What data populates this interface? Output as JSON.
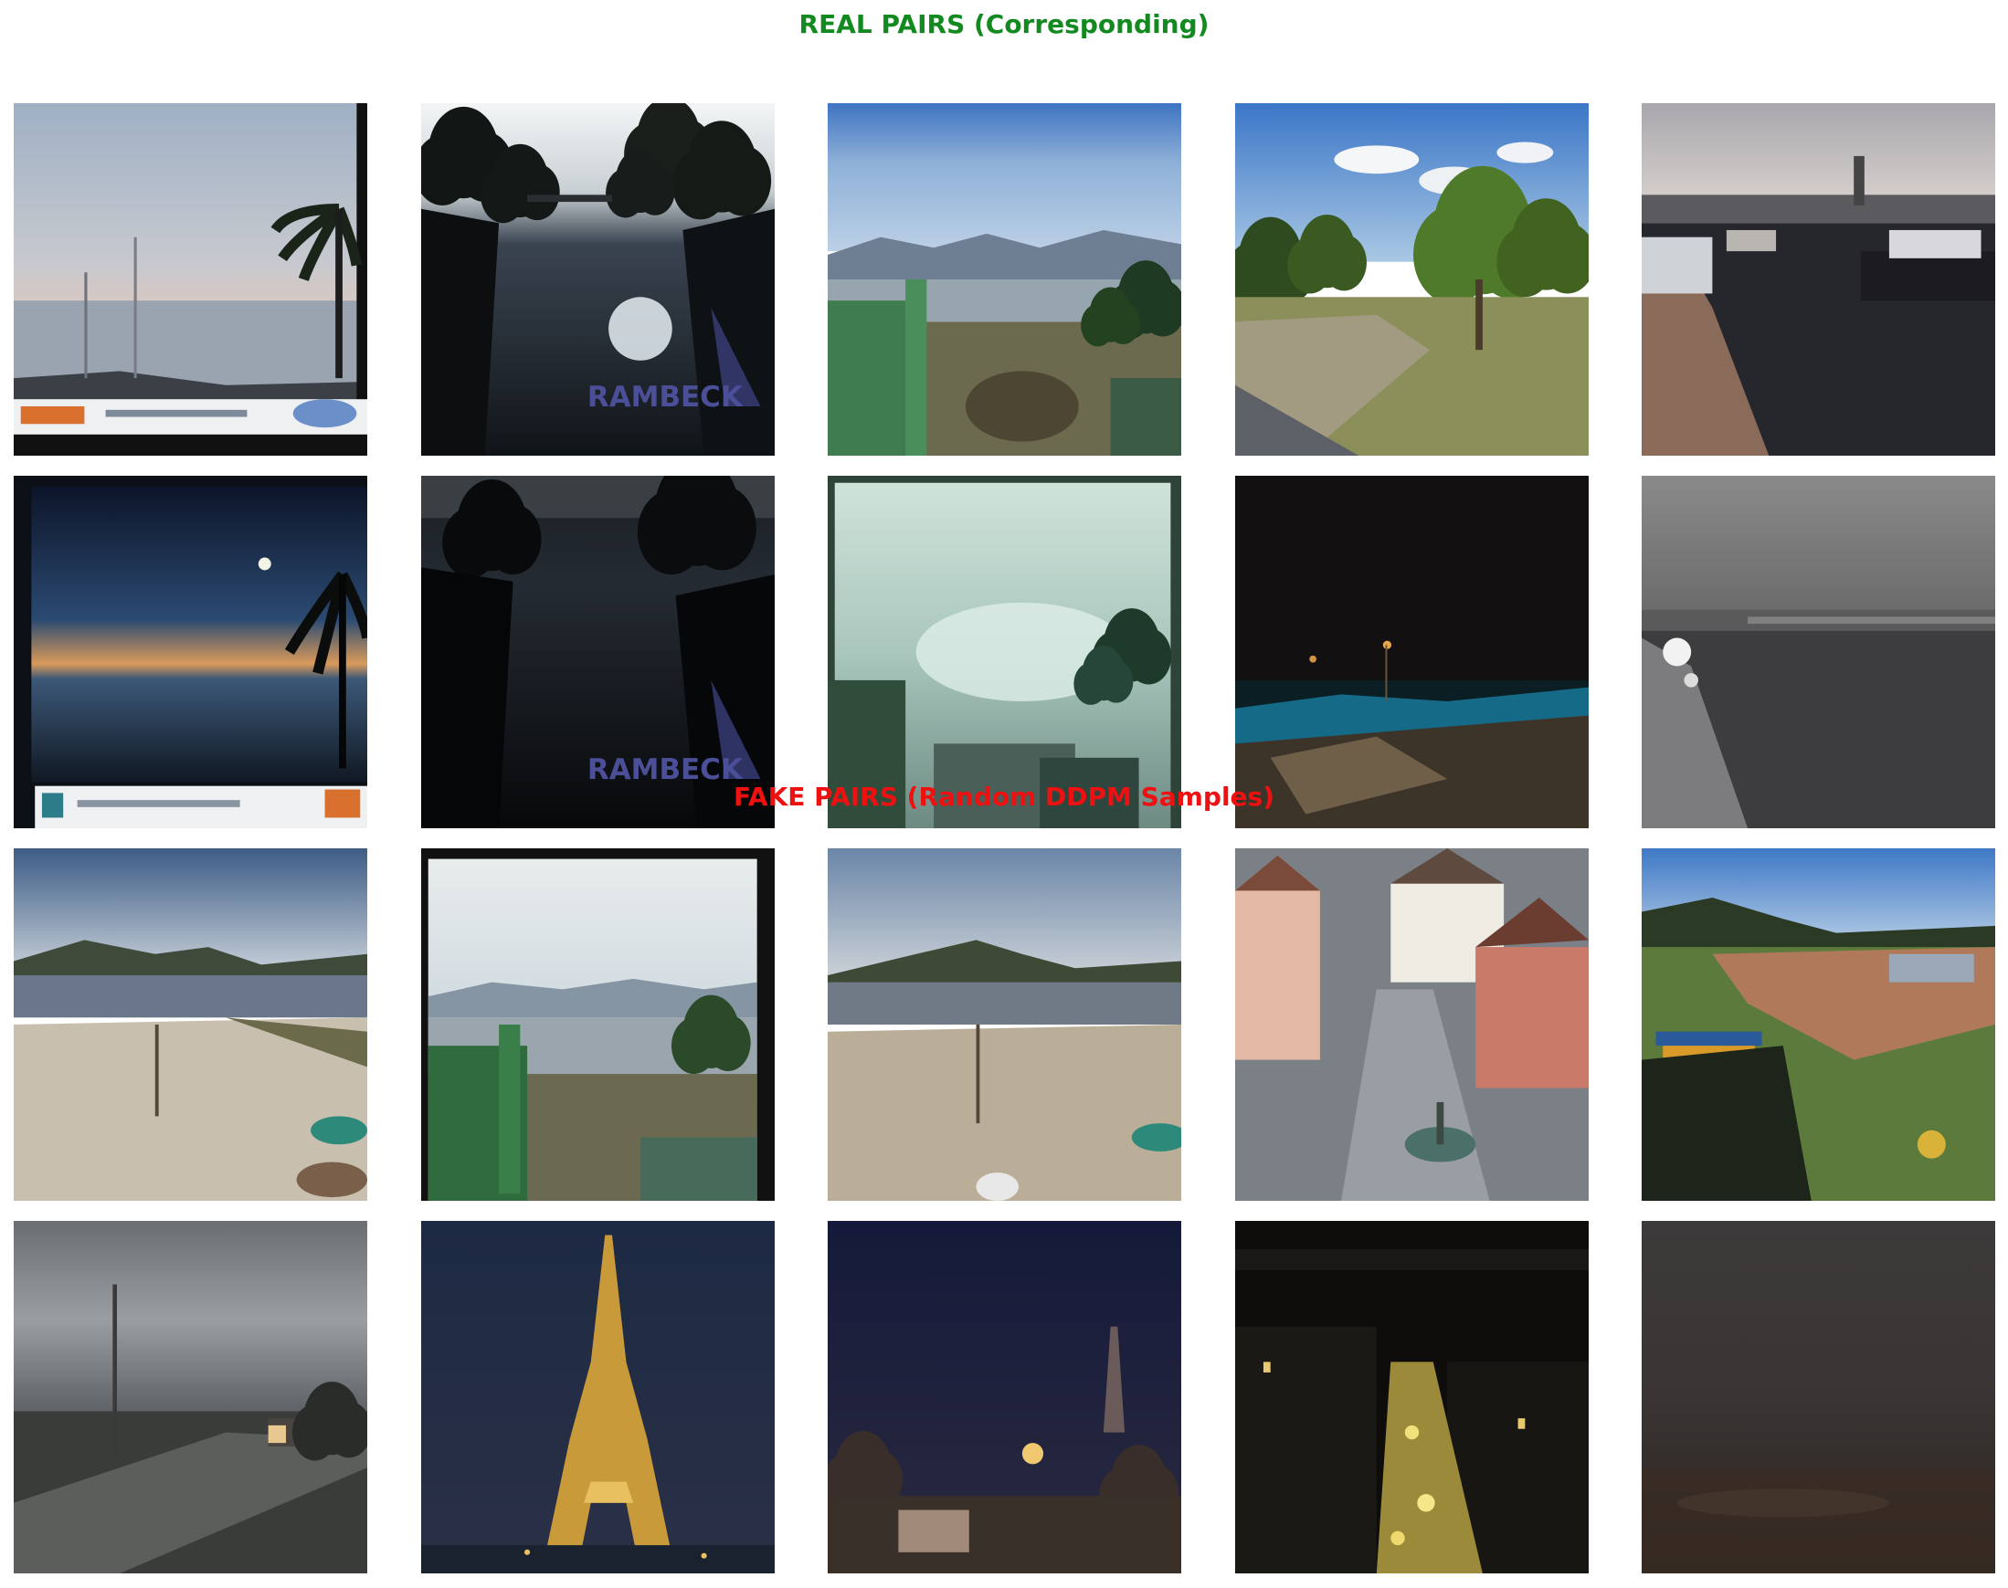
{
  "titles": {
    "real": "REAL PAIRS (Corresponding)",
    "fake": "FAKE PAIRS (Random DDPM Samples)"
  },
  "colors": {
    "real_title": "#138a1f",
    "fake_title": "#ee1111",
    "background": "#ffffff"
  },
  "panels": [
    {
      "row": 0,
      "col": 0,
      "scene": "lake-sunset-with-palm-and-logo-banner"
    },
    {
      "row": 0,
      "col": 1,
      "scene": "dark-river-with-trees-rambeck-watermark"
    },
    {
      "row": 0,
      "col": 2,
      "scene": "lake-mountains-green-building"
    },
    {
      "row": 0,
      "col": 3,
      "scene": "park-trees-blue-sky"
    },
    {
      "row": 0,
      "col": 4,
      "scene": "harbor-ships-dusk"
    },
    {
      "row": 1,
      "col": 0,
      "scene": "lake-night-moon-palm"
    },
    {
      "row": 1,
      "col": 1,
      "scene": "dark-river-rambeck-watermark"
    },
    {
      "row": 1,
      "col": 2,
      "scene": "foggy-lake-green-building"
    },
    {
      "row": 1,
      "col": 3,
      "scene": "night-park-lights"
    },
    {
      "row": 1,
      "col": 4,
      "scene": "foggy-harbor-grey"
    },
    {
      "row": 2,
      "col": 0,
      "scene": "lake-beach-hills"
    },
    {
      "row": 2,
      "col": 1,
      "scene": "lake-mountains-green-building-framed"
    },
    {
      "row": 2,
      "col": 2,
      "scene": "lake-beach-hills-2"
    },
    {
      "row": 2,
      "col": 3,
      "scene": "town-square-houses-fountain"
    },
    {
      "row": 2,
      "col": 4,
      "scene": "construction-field-hills"
    },
    {
      "row": 3,
      "col": 0,
      "scene": "overcast-road-lamp"
    },
    {
      "row": 3,
      "col": 1,
      "scene": "eiffel-tower-night"
    },
    {
      "row": 3,
      "col": 2,
      "scene": "night-church-lights"
    },
    {
      "row": 3,
      "col": 3,
      "scene": "night-city-street-lights"
    },
    {
      "row": 3,
      "col": 4,
      "scene": "dark-fog-brown"
    }
  ]
}
